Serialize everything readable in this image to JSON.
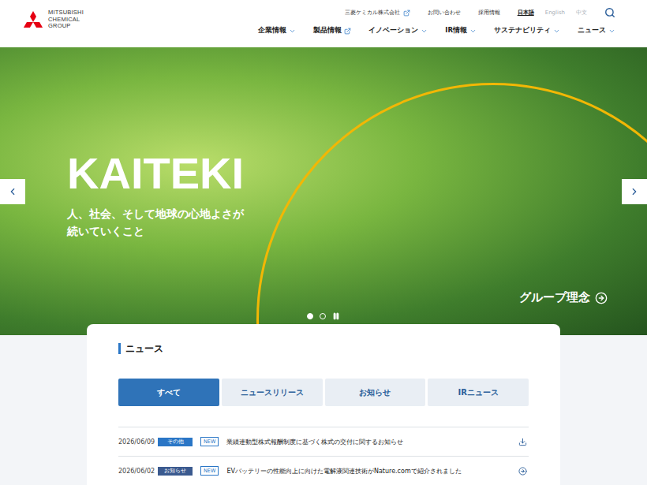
{
  "logo": {
    "lines": [
      "MITSUBISHI",
      "CHEMICAL",
      "GROUP"
    ]
  },
  "utility_links": [
    {
      "label": "三菱ケミカル株式会社",
      "external": true
    },
    {
      "label": "お問い合わせ",
      "external": false
    },
    {
      "label": "採用情報",
      "external": false
    }
  ],
  "languages": [
    {
      "label": "日本語",
      "selected": true
    },
    {
      "label": "English",
      "selected": false
    },
    {
      "label": "中文",
      "selected": false
    }
  ],
  "nav": [
    {
      "label": "企業情報",
      "kind": "dropdown"
    },
    {
      "label": "製品情報",
      "kind": "external"
    },
    {
      "label": "イノベーション",
      "kind": "dropdown"
    },
    {
      "label": "IR情報",
      "kind": "dropdown"
    },
    {
      "label": "サステナビリティ",
      "kind": "dropdown"
    },
    {
      "label": "ニュース",
      "kind": "dropdown"
    }
  ],
  "hero": {
    "title": "KAITEKI",
    "subtitle_lines": [
      "人、社会、そして地球の心地よさが",
      "続いていくこと"
    ],
    "link": "グループ理念",
    "slides": [
      {
        "selected": true
      },
      {
        "selected": false
      }
    ],
    "playing": true
  },
  "news": {
    "title": "ニュース",
    "tabs": [
      {
        "label": "すべて",
        "selected": true
      },
      {
        "label": "ニュースリリース",
        "selected": false
      },
      {
        "label": "お知らせ",
        "selected": false
      },
      {
        "label": "IRニュース",
        "selected": false
      }
    ],
    "items": [
      {
        "date": "2026/06/09",
        "tag": "その他",
        "color": "#2a76c6",
        "badge": "NEW",
        "title": "業績連動型株式報酬制度に基づく株式の交付に関するお知らせ",
        "kind": "download"
      },
      {
        "date": "2026/06/02",
        "tag": "お知らせ",
        "color": "#3b5a8f",
        "badge": "NEW",
        "title": "EVバッテリーの性能向上に向けた電解液関連技術がNature.comで紹介されました",
        "kind": "link"
      }
    ]
  }
}
